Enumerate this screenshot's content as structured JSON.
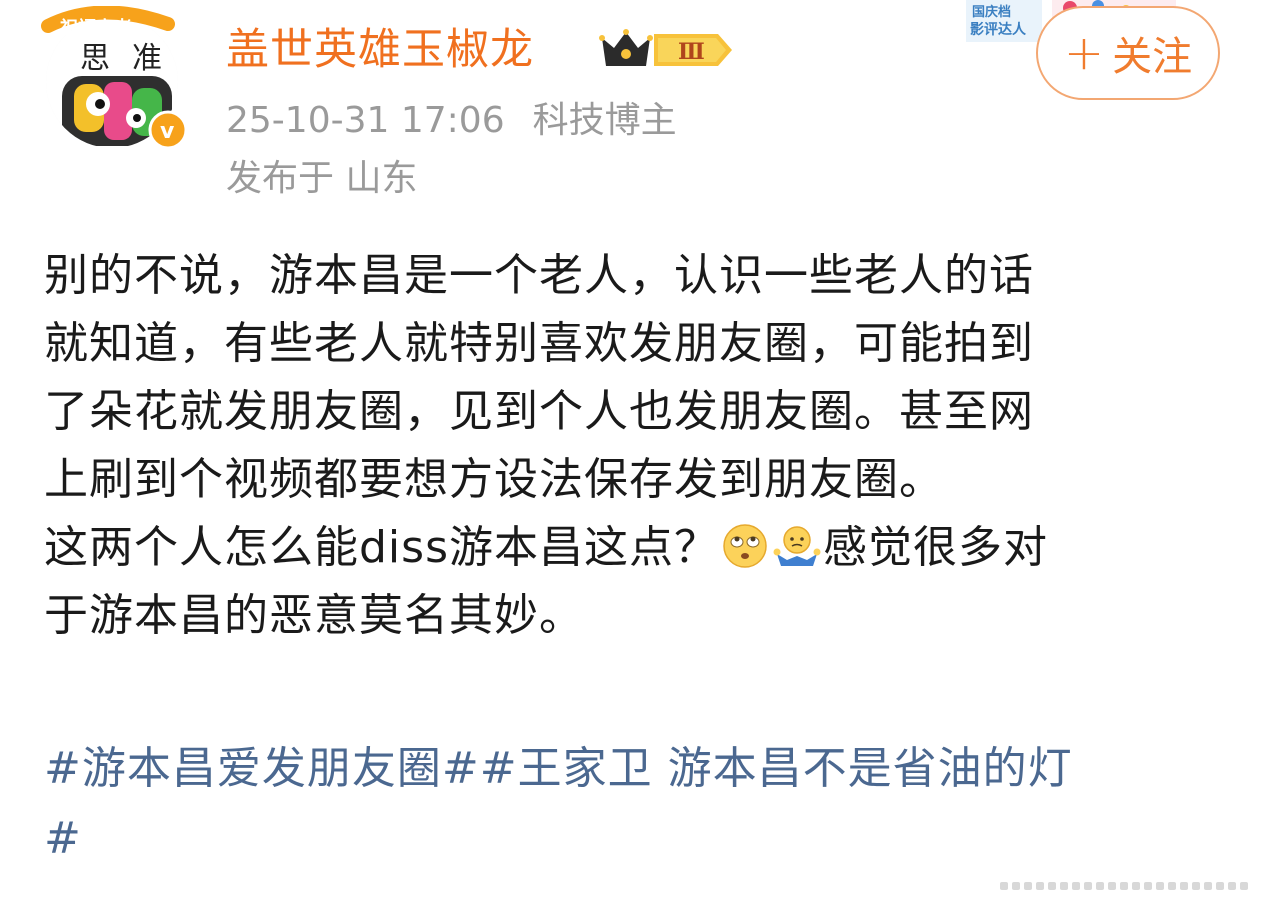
{
  "author": {
    "name": "盖世英雄玉椒龙",
    "level_badge": "Ⅲ",
    "avatar_caption": "祝福高考"
  },
  "top_banner": {
    "line1": "国庆档",
    "line2": "影评达人"
  },
  "follow_button": {
    "plus": "+",
    "label": "关注"
  },
  "meta": {
    "timestamp": "25-10-31 17:06",
    "tag": "科技博主",
    "location": "发布于 山东"
  },
  "post": {
    "lines": [
      "别的不说，游本昌是一个老人，认识一些老人的话",
      "就知道，有些老人就特别喜欢发朋友圈，可能拍到",
      "了朵花就发朋友圈，见到个人也发朋友圈。甚至网",
      "上刷到个视频都要想方设法保存发到朋友圈。"
    ],
    "line5_prefix": "这两个人怎么能diss游本昌这点？",
    "line5_suffix": "感觉很多对",
    "line6": "于游本昌的恶意莫名其妙。",
    "emojis": [
      "eye-roll-emoji",
      "shrug-emoji"
    ]
  },
  "hashtags": {
    "tag1": "#游本昌爱发朋友圈#",
    "tag2": "#王家卫 游本昌不是省油的灯",
    "tag2_end": "#"
  },
  "colors": {
    "author": "#f0701f",
    "follow_border": "#f3a772",
    "meta": "#9a9a9a",
    "body": "#1a1a1a",
    "hashtag": "#4b6890"
  }
}
